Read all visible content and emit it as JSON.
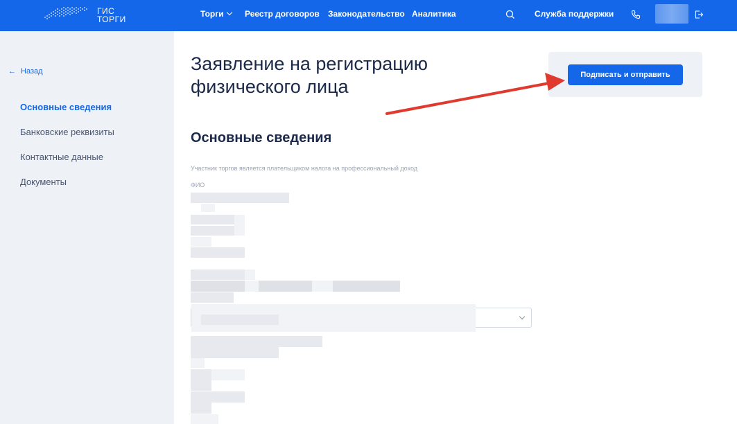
{
  "header": {
    "logo_line1": "ГИС",
    "logo_line2": "ТОРГИ",
    "nav": [
      {
        "label": "Торги"
      },
      {
        "label": "Реестр договоров"
      },
      {
        "label": "Законодательство"
      },
      {
        "label": "Аналитика"
      }
    ],
    "support_label": "Служба поддержки",
    "icons": [
      "search-icon",
      "phone-icon",
      "logout-icon"
    ],
    "bg_color": "#1367e8"
  },
  "sidebar": {
    "back_label": "Назад",
    "items": [
      {
        "label": "Основные сведения",
        "active": true
      },
      {
        "label": "Банковские реквизиты",
        "active": false
      },
      {
        "label": "Контактные данные",
        "active": false
      },
      {
        "label": "Документы",
        "active": false
      }
    ]
  },
  "main": {
    "title_line1": "Заявление на регистрацию",
    "title_line2": "физического лица",
    "submit_label": "Подписать и отправить",
    "section_title": "Основные сведения",
    "hint": "Участник торгов является плательщиком налога на профессиональный доход",
    "fio_label": "ФИО"
  },
  "colors": {
    "accent": "#1367e8",
    "annotation_arrow": "#e03a2f"
  }
}
